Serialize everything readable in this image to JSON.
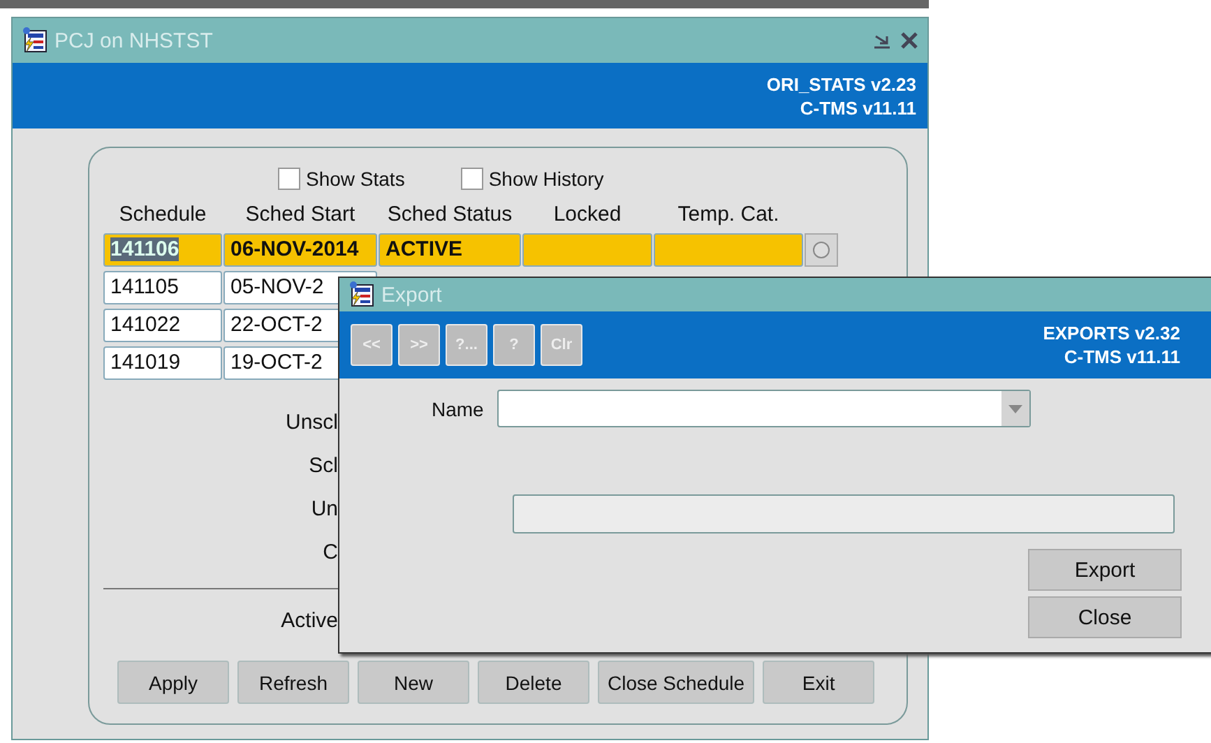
{
  "main_window": {
    "title": "PCJ on NHSTST",
    "module": "ORI_STATS v2.23",
    "version": "C-TMS v11.11",
    "options": [
      {
        "label": "Show Stats",
        "checked": false
      },
      {
        "label": "Show History",
        "checked": false
      }
    ],
    "columns": [
      "Schedule",
      "Sched Start",
      "Sched Status",
      "Locked",
      "Temp. Cat."
    ],
    "rows": [
      {
        "schedule": "141106",
        "start": "06-NOV-2014",
        "status": "ACTIVE",
        "selected": true
      },
      {
        "schedule": "141105",
        "start": "05-NOV-2",
        "selected": false
      },
      {
        "schedule": "141022",
        "start": "22-OCT-2",
        "selected": false
      },
      {
        "schedule": "141019",
        "start": "19-OCT-2",
        "selected": false
      }
    ],
    "labels": [
      "Unscl",
      "Scl",
      "Un",
      "C"
    ],
    "footer_label": "Active",
    "buttons": [
      "Apply",
      "Refresh",
      "New",
      "Delete",
      "Close Schedule",
      "Exit"
    ]
  },
  "dialog": {
    "title": "Export",
    "module": "EXPORTS v2.32",
    "version": "C-TMS v11.11",
    "toolbar": [
      {
        "label": "<<",
        "disabled": true
      },
      {
        "label": ">>",
        "disabled": true
      },
      {
        "label": "?...",
        "disabled": true
      },
      {
        "label": "?",
        "disabled": true
      },
      {
        "label": "Clr",
        "disabled": true
      }
    ],
    "name_label": "Name",
    "buttons": [
      "Export",
      "Close"
    ]
  }
}
